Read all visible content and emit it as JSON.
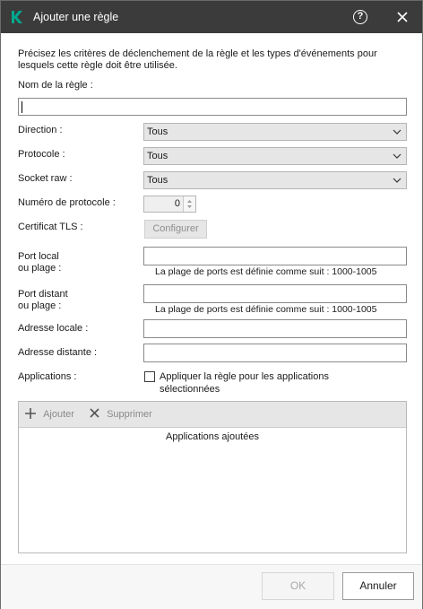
{
  "window": {
    "title": "Ajouter une règle"
  },
  "intro": "Précisez les critères de déclenchement de la règle et les types d'événements pour lesquels cette règle doit être utilisée.",
  "fields": {
    "rule_name_label": "Nom de la règle :",
    "rule_name_value": "",
    "direction_label": "Direction :",
    "direction_value": "Tous",
    "protocol_label": "Protocole :",
    "protocol_value": "Tous",
    "socket_label": "Socket raw :",
    "socket_value": "Tous",
    "protocol_number_label": "Numéro de protocole :",
    "protocol_number_value": "0",
    "tls_label": "Certificat TLS :",
    "tls_button": "Configurer",
    "local_port_label_1": "Port local",
    "local_port_label_2": "ou plage :",
    "local_port_value": "",
    "local_port_hint": "La plage de ports est définie comme suit : 1000-1005",
    "remote_port_label_1": "Port distant",
    "remote_port_label_2": "ou plage :",
    "remote_port_value": "",
    "remote_port_hint": "La plage de ports est définie comme suit : 1000-1005",
    "local_address_label": "Adresse locale :",
    "local_address_value": "",
    "remote_address_label": "Adresse distante :",
    "remote_address_value": "",
    "applications_label": "Applications :",
    "apply_checkbox_line1": "Appliquer la règle pour les applications",
    "apply_checkbox_line2": "sélectionnées",
    "apply_checked": false
  },
  "apps_panel": {
    "add_label": "Ajouter",
    "remove_label": "Supprimer",
    "column_header": "Applications ajoutées"
  },
  "footer": {
    "ok_label": "OK",
    "cancel_label": "Annuler"
  },
  "colors": {
    "titlebar": "#3b3b3b",
    "logo": "#00a88e",
    "disabled_text": "#8e8e8e"
  }
}
